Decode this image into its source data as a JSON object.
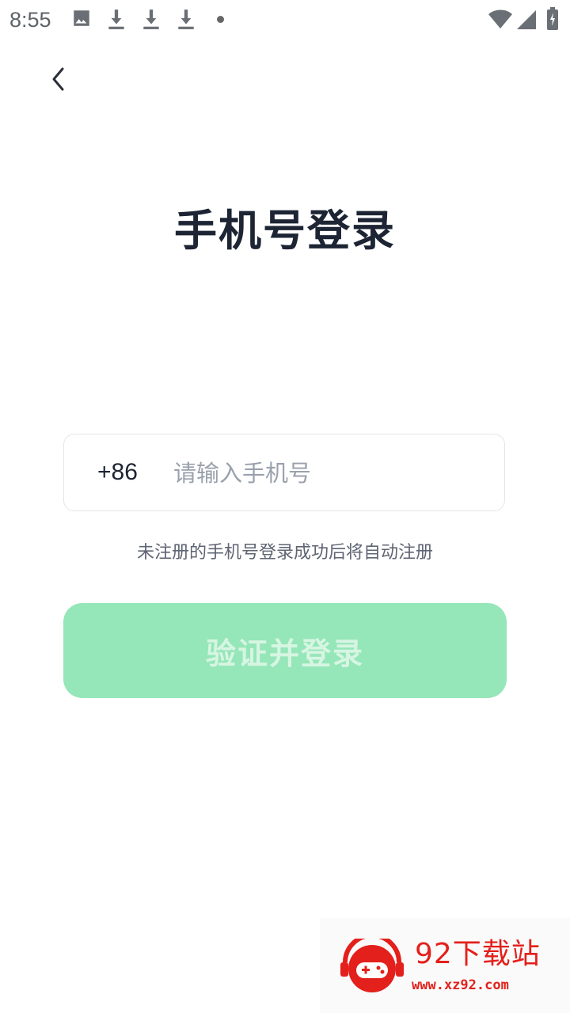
{
  "status_bar": {
    "time": "8:55",
    "icons": [
      "image-icon",
      "download-icon",
      "download-icon",
      "download-icon",
      "dot-icon",
      "wifi-icon",
      "signal-icon",
      "battery-icon"
    ]
  },
  "header": {
    "back_icon": "chevron-left-icon"
  },
  "login": {
    "title": "手机号登录",
    "country_code": "+86",
    "phone_placeholder": "请输入手机号",
    "phone_value": "",
    "hint": "未注册的手机号登录成功后将自动注册",
    "submit_label": "验证并登录",
    "submit_color": "#95e6b8"
  },
  "watermark": {
    "name": "92下载站",
    "url": "www.xz92.com",
    "color": "#e3201b"
  }
}
